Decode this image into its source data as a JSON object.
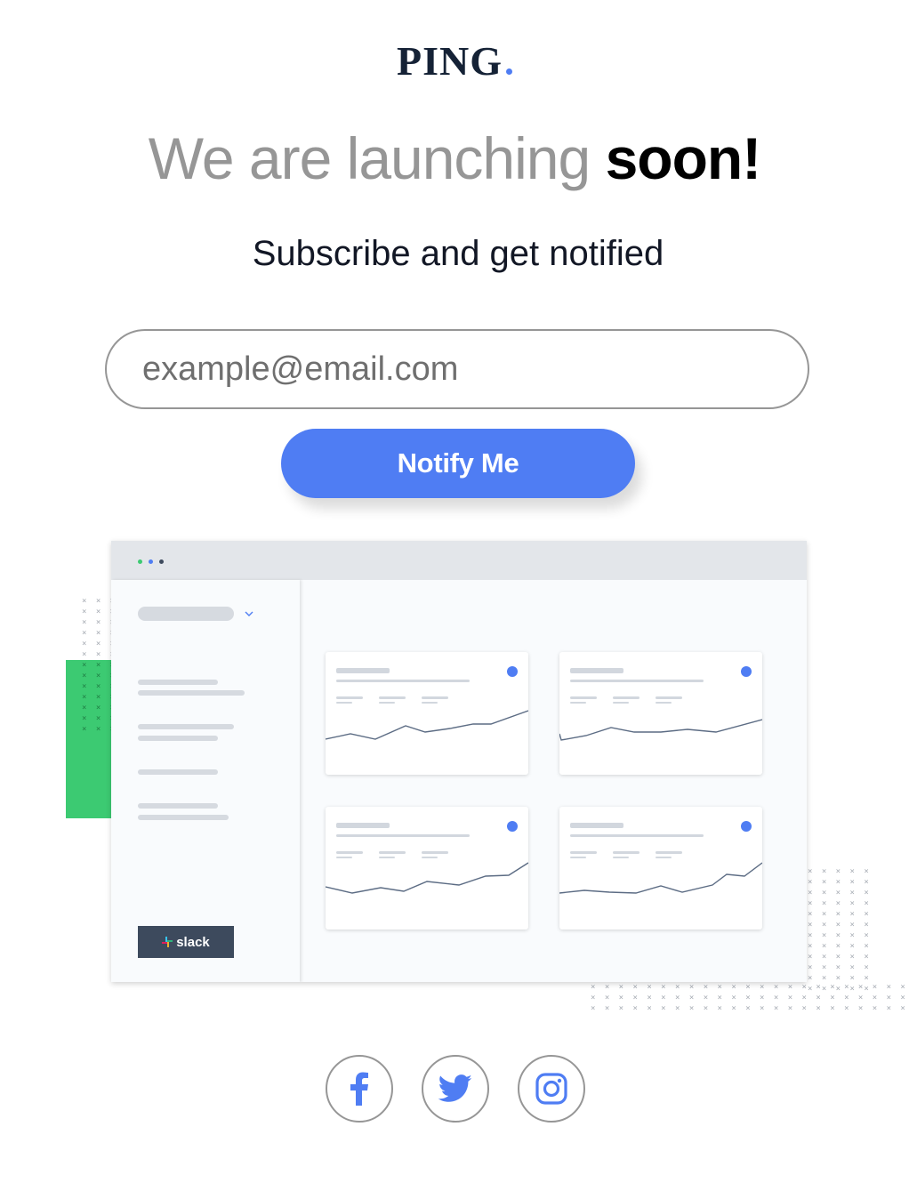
{
  "brand": {
    "name": "PING",
    "accent_color": "#4f7df3"
  },
  "hero": {
    "headline_light": "We are launching",
    "headline_bold": "soon!",
    "subheadline": "Subscribe and get notified"
  },
  "form": {
    "email_placeholder": "example@email.com",
    "email_value": "",
    "submit_label": "Notify Me"
  },
  "illustration": {
    "window_dot_colors": [
      "#3cca72",
      "#4f7df3",
      "#3d4a5d"
    ],
    "slack_label": "slack",
    "card_count": 4
  },
  "social": {
    "links": [
      {
        "icon": "facebook-icon"
      },
      {
        "icon": "twitter-icon"
      },
      {
        "icon": "instagram-icon"
      }
    ]
  }
}
